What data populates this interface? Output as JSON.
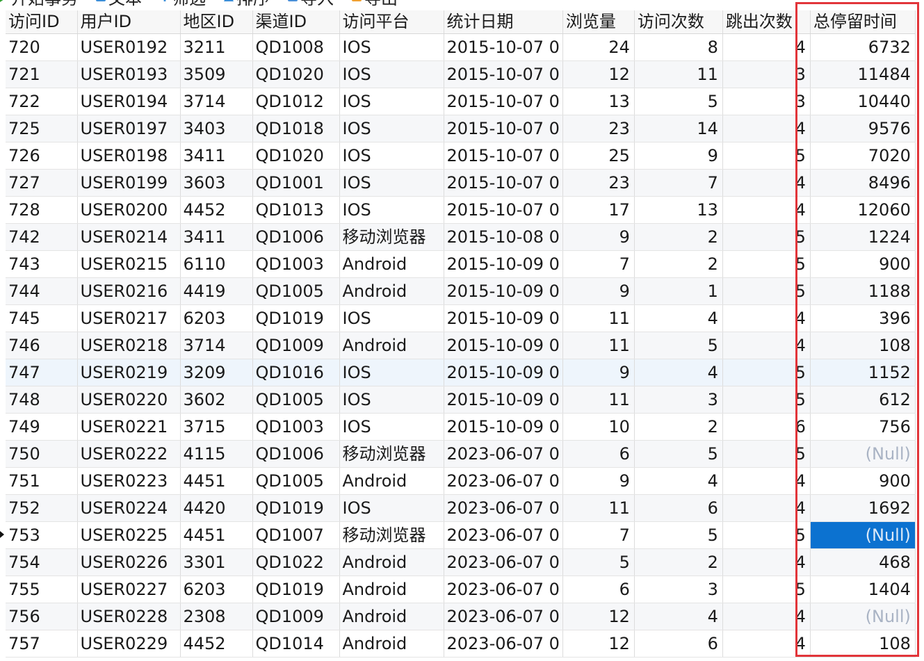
{
  "toolbar": {
    "buttons": [
      {
        "label": "开始事务",
        "icon": "play-icon"
      },
      {
        "label": "文本",
        "icon": "text-icon"
      },
      {
        "label": "筛选",
        "icon": "filter-icon"
      },
      {
        "label": "排序",
        "icon": "sort-icon"
      },
      {
        "label": "导入",
        "icon": "import-icon"
      },
      {
        "label": "导出",
        "icon": "export-icon"
      }
    ]
  },
  "colors": {
    "highlight_box": "#e2353a",
    "selected_cell": "#0c72d0",
    "null_text": "#a9b3c4"
  },
  "grid": {
    "columns": [
      "访问ID",
      "用户ID",
      "地区ID",
      "渠道ID",
      "访问平台",
      "统计日期",
      "浏览量",
      "访问次数",
      "跳出次数",
      "总停留时间"
    ],
    "rows": [
      [
        "720",
        "USER0192",
        "3211",
        "QD1008",
        "IOS",
        "2015-10-07 0",
        "24",
        "8",
        "4",
        "6732"
      ],
      [
        "721",
        "USER0193",
        "3509",
        "QD1020",
        "IOS",
        "2015-10-07 0",
        "12",
        "11",
        "3",
        "11484"
      ],
      [
        "722",
        "USER0194",
        "3714",
        "QD1012",
        "IOS",
        "2015-10-07 0",
        "13",
        "5",
        "3",
        "10440"
      ],
      [
        "725",
        "USER0197",
        "3403",
        "QD1018",
        "IOS",
        "2015-10-07 0",
        "23",
        "14",
        "4",
        "9576"
      ],
      [
        "726",
        "USER0198",
        "3411",
        "QD1020",
        "IOS",
        "2015-10-07 0",
        "25",
        "9",
        "5",
        "7020"
      ],
      [
        "727",
        "USER0199",
        "3603",
        "QD1001",
        "IOS",
        "2015-10-07 0",
        "23",
        "7",
        "4",
        "8496"
      ],
      [
        "728",
        "USER0200",
        "4452",
        "QD1013",
        "IOS",
        "2015-10-07 0",
        "17",
        "13",
        "4",
        "12060"
      ],
      [
        "742",
        "USER0214",
        "3411",
        "QD1006",
        "移动浏览器",
        "2015-10-08 0",
        "9",
        "2",
        "5",
        "1224"
      ],
      [
        "743",
        "USER0215",
        "6110",
        "QD1003",
        "Android",
        "2015-10-09 0",
        "7",
        "2",
        "5",
        "900"
      ],
      [
        "744",
        "USER0216",
        "4419",
        "QD1005",
        "Android",
        "2015-10-09 0",
        "9",
        "1",
        "5",
        "1188"
      ],
      [
        "745",
        "USER0217",
        "6203",
        "QD1019",
        "IOS",
        "2015-10-09 0",
        "11",
        "4",
        "4",
        "396"
      ],
      [
        "746",
        "USER0218",
        "3714",
        "QD1009",
        "Android",
        "2015-10-09 0",
        "11",
        "5",
        "4",
        "108"
      ],
      [
        "747",
        "USER0219",
        "3209",
        "QD1016",
        "IOS",
        "2015-10-09 0",
        "9",
        "4",
        "5",
        "1152"
      ],
      [
        "748",
        "USER0220",
        "3602",
        "QD1005",
        "IOS",
        "2015-10-09 0",
        "11",
        "3",
        "5",
        "612"
      ],
      [
        "749",
        "USER0221",
        "3715",
        "QD1003",
        "IOS",
        "2015-10-09 0",
        "10",
        "2",
        "6",
        "756"
      ],
      [
        "750",
        "USER0222",
        "4115",
        "QD1006",
        "移动浏览器",
        "2023-06-07 0",
        "6",
        "5",
        "5",
        "(Null)"
      ],
      [
        "751",
        "USER0223",
        "4451",
        "QD1005",
        "Android",
        "2023-06-07 0",
        "9",
        "4",
        "4",
        "900"
      ],
      [
        "752",
        "USER0224",
        "4420",
        "QD1019",
        "IOS",
        "2023-06-07 0",
        "11",
        "6",
        "4",
        "1692"
      ],
      [
        "753",
        "USER0225",
        "4451",
        "QD1007",
        "移动浏览器",
        "2023-06-07 0",
        "7",
        "5",
        "5",
        "(Null)"
      ],
      [
        "754",
        "USER0226",
        "3301",
        "QD1022",
        "Android",
        "2023-06-07 0",
        "5",
        "2",
        "4",
        "468"
      ],
      [
        "755",
        "USER0227",
        "6203",
        "QD1019",
        "Android",
        "2023-06-07 0",
        "6",
        "3",
        "5",
        "1404"
      ],
      [
        "756",
        "USER0228",
        "2308",
        "QD1009",
        "Android",
        "2023-06-07 0",
        "12",
        "4",
        "4",
        "(Null)"
      ],
      [
        "757",
        "USER0229",
        "4452",
        "QD1014",
        "Android",
        "2023-06-07 0",
        "12",
        "6",
        "4",
        "108"
      ]
    ],
    "selected_row": 18,
    "selected_column": 9
  }
}
